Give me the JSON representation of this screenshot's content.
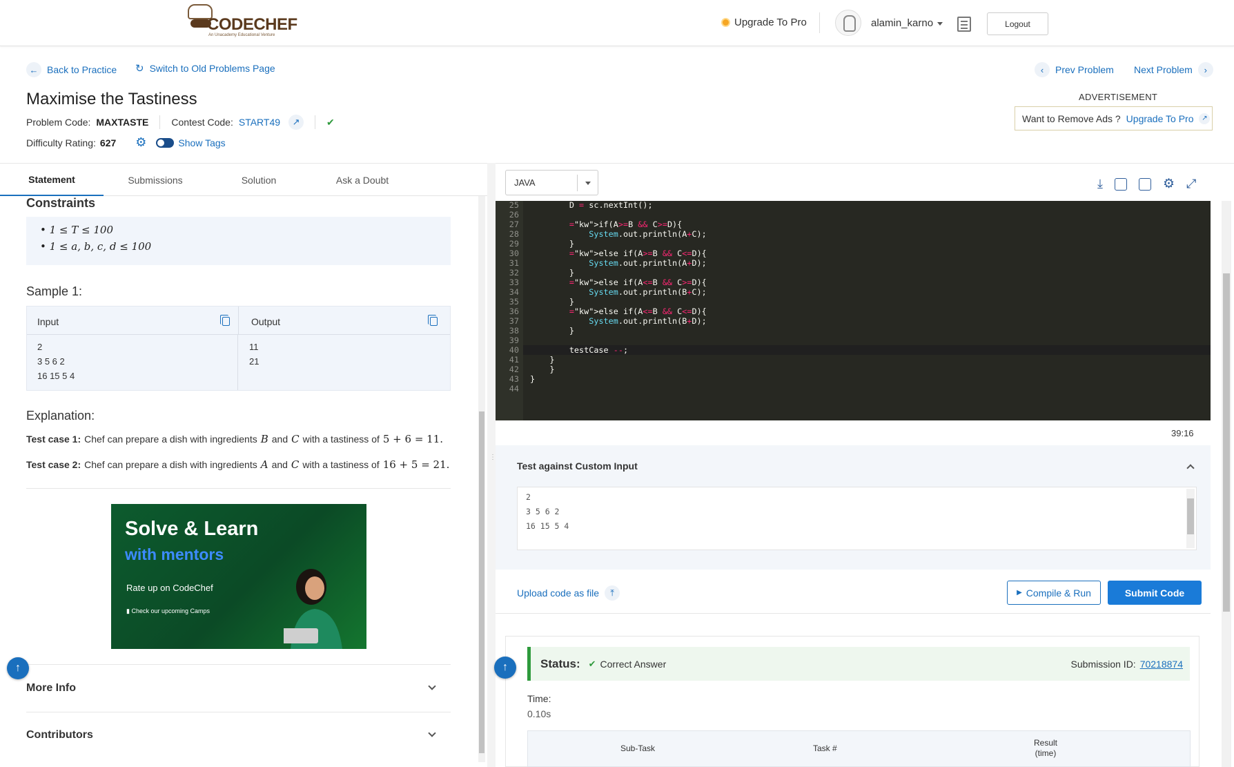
{
  "header": {
    "logo_text": "CODECHEF",
    "logo_tagline": "An Unacademy Educational Venture",
    "upgrade_label": "Upgrade To Pro",
    "username": "alamin_karno",
    "logout_label": "Logout"
  },
  "nav": {
    "back_label": "Back to Practice",
    "switch_label": "Switch to Old Problems Page",
    "prev_label": "Prev Problem",
    "next_label": "Next Problem"
  },
  "problem": {
    "title": "Maximise the Tastiness",
    "code_label": "Problem Code:",
    "code": "MAXTASTE",
    "contest_label": "Contest Code:",
    "contest": "START49",
    "difficulty_label": "Difficulty Rating:",
    "difficulty": "627",
    "show_tags_label": "Show Tags"
  },
  "ad": {
    "label": "ADVERTISEMENT",
    "remove_text": "Want to Remove Ads ?",
    "upgrade_link": "Upgrade To Pro"
  },
  "tabs": [
    "Statement",
    "Submissions",
    "Solution",
    "Ask a Doubt"
  ],
  "statement": {
    "constraints_title": "Constraints",
    "constraints": [
      "1 ≤ T ≤ 100",
      "1 ≤ a, b, c, d ≤ 100"
    ],
    "sample_title": "Sample 1:",
    "input_header": "Input",
    "output_header": "Output",
    "input_lines": [
      "2",
      "3 5 6 2",
      "16 15 5 4"
    ],
    "output_lines": [
      "11",
      "21"
    ],
    "explanation_title": "Explanation:",
    "explanations": [
      {
        "label": "Test case 1:",
        "pre": "Chef can prepare a dish with ingredients",
        "v1": "B",
        "and": "and",
        "v2": "C",
        "mid": "with a tastiness of",
        "expr": "5 + 6 = 11."
      },
      {
        "label": "Test case 2:",
        "pre": "Chef can prepare a dish with ingredients",
        "v1": "A",
        "and": "and",
        "v2": "C",
        "mid": "with a tastiness of",
        "expr": "16 + 5 = 21."
      }
    ],
    "banner": {
      "line1": "Solve & Learn",
      "line2": "with mentors",
      "line3": "Rate up on CodeChef",
      "line4": "Check our upcoming Camps"
    },
    "more_info": "More Info",
    "contributors": "Contributors"
  },
  "editor": {
    "language": "JAVA",
    "cursor_position": "39:16",
    "lines": [
      {
        "n": "25",
        "code": "        D = sc.nextInt();"
      },
      {
        "n": "26",
        "code": ""
      },
      {
        "n": "27",
        "code": "        if(A>=B && C>=D){"
      },
      {
        "n": "28",
        "code": "            System.out.println(A+C);"
      },
      {
        "n": "29",
        "code": "        }"
      },
      {
        "n": "30",
        "code": "        else if(A>=B && C<=D){"
      },
      {
        "n": "31",
        "code": "            System.out.println(A+D);"
      },
      {
        "n": "32",
        "code": "        }"
      },
      {
        "n": "33",
        "code": "        else if(A<=B && C>=D){"
      },
      {
        "n": "34",
        "code": "            System.out.println(B+C);"
      },
      {
        "n": "35",
        "code": "        }"
      },
      {
        "n": "36",
        "code": "        else if(A<=B && C<=D){"
      },
      {
        "n": "37",
        "code": "            System.out.println(B+D);"
      },
      {
        "n": "38",
        "code": "        }"
      },
      {
        "n": "39",
        "code": ""
      },
      {
        "n": "40",
        "code": "        testCase --;"
      },
      {
        "n": "41",
        "code": "    }"
      },
      {
        "n": "42",
        "code": "    }"
      },
      {
        "n": "43",
        "code": "}"
      },
      {
        "n": "44",
        "code": ""
      }
    ]
  },
  "custom_input": {
    "title": "Test against Custom Input",
    "lines": [
      "2",
      "3 5 6 2",
      "16 15 5 4"
    ]
  },
  "actions": {
    "upload_label": "Upload code as file",
    "compile_label": "Compile & Run",
    "submit_label": "Submit Code"
  },
  "result": {
    "status_label": "Status:",
    "status_value": "Correct Answer",
    "submission_label": "Submission ID:",
    "submission_id": "70218874",
    "time_label": "Time:",
    "time_value": "0.10s",
    "col_subtask": "Sub-Task",
    "col_task": "Task #",
    "col_result": "Result",
    "col_result_sub": "(time)"
  },
  "colors": {
    "accent": "#1a6fbd",
    "primary_button": "#1a7bd8",
    "success": "#2e9a3c",
    "editor_bg": "#272822"
  }
}
